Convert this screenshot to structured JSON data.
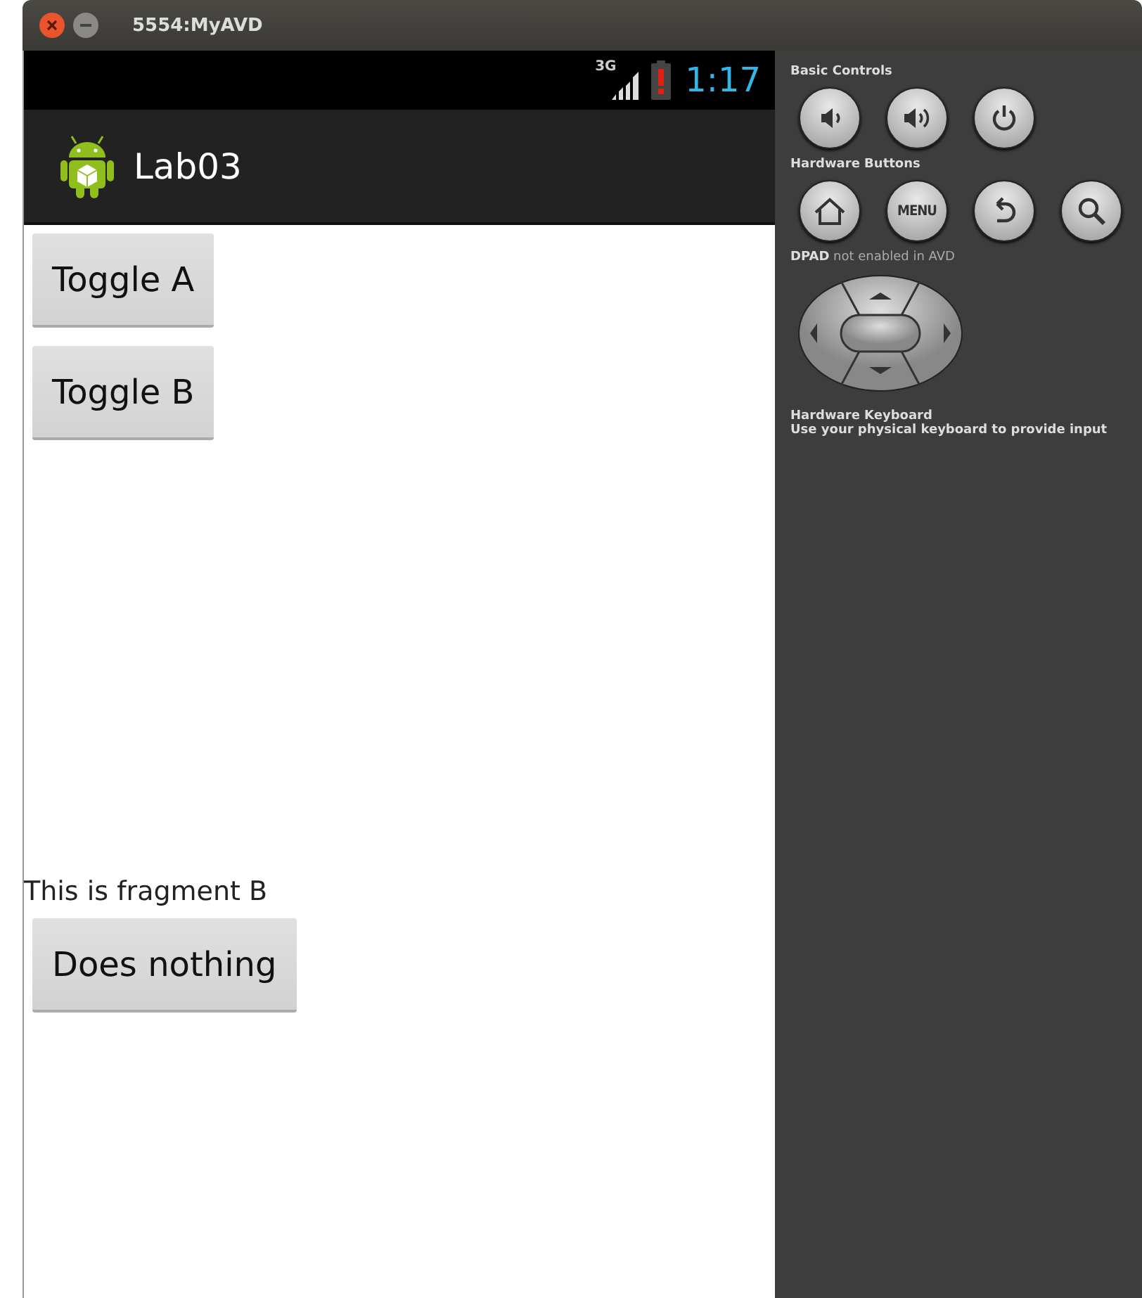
{
  "window": {
    "title": "5554:MyAVD"
  },
  "status_bar": {
    "network": "3G",
    "time": "1:17"
  },
  "action_bar": {
    "title": "Lab03"
  },
  "buttons": [
    {
      "label": "Toggle A"
    },
    {
      "label": "Toggle B"
    }
  ],
  "fragment_b": {
    "text": "This is fragment B",
    "button": "Does nothing"
  },
  "panel": {
    "basic_controls": {
      "heading": "Basic Controls",
      "buttons": [
        {
          "kind": "volume-down"
        },
        {
          "kind": "volume-up"
        },
        {
          "kind": "power"
        }
      ]
    },
    "hardware_buttons": {
      "heading": "Hardware Buttons",
      "buttons": [
        {
          "kind": "home"
        },
        {
          "kind": "menu",
          "label": "MENU"
        },
        {
          "kind": "back"
        },
        {
          "kind": "search"
        }
      ]
    },
    "dpad": {
      "heading": "**DPAD** not enabled in AVD"
    },
    "keyboard": {
      "heading": "Hardware Keyboard",
      "text": "Use your physical keyboard to provide input"
    }
  }
}
